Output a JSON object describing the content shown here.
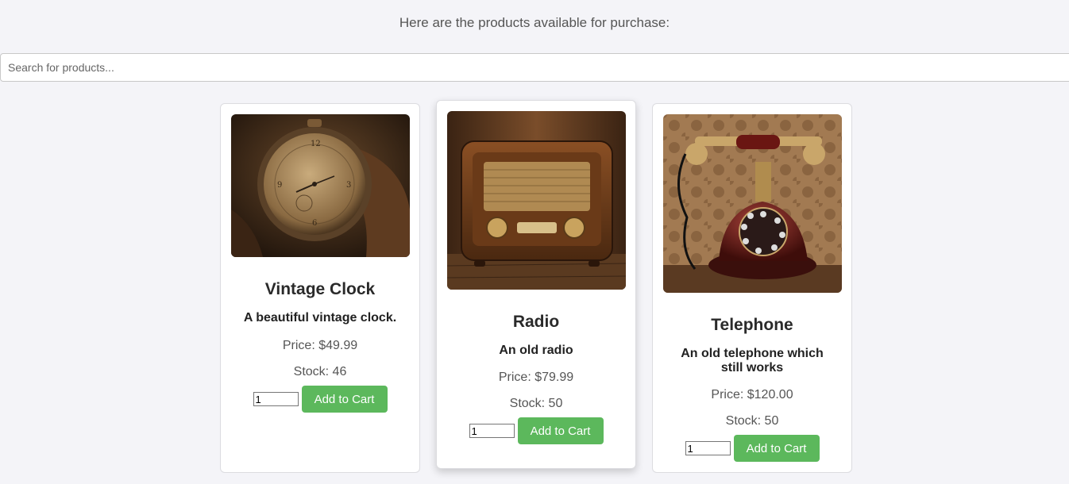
{
  "intro_text": "Here are the products available for purchase:",
  "search": {
    "placeholder": "Search for products..."
  },
  "accent_color": "#5cb85c",
  "products": [
    {
      "name": "Vintage Clock",
      "description": "A beautiful vintage clock.",
      "price": "Price: $49.99",
      "stock": "Stock: 46",
      "quantity": "1",
      "button_label": "Add to Cart",
      "image": "vintage-pocket-watch-photo"
    },
    {
      "name": "Radio",
      "description": "An old radio",
      "price": "Price: $79.99",
      "stock": "Stock: 50",
      "quantity": "1",
      "button_label": "Add to Cart",
      "image": "vintage-wooden-radio-photo"
    },
    {
      "name": "Telephone",
      "description": "An old telephone which still works",
      "price": "Price: $120.00",
      "stock": "Stock: 50",
      "quantity": "1",
      "button_label": "Add to Cart",
      "image": "antique-rotary-telephone-photo"
    }
  ]
}
